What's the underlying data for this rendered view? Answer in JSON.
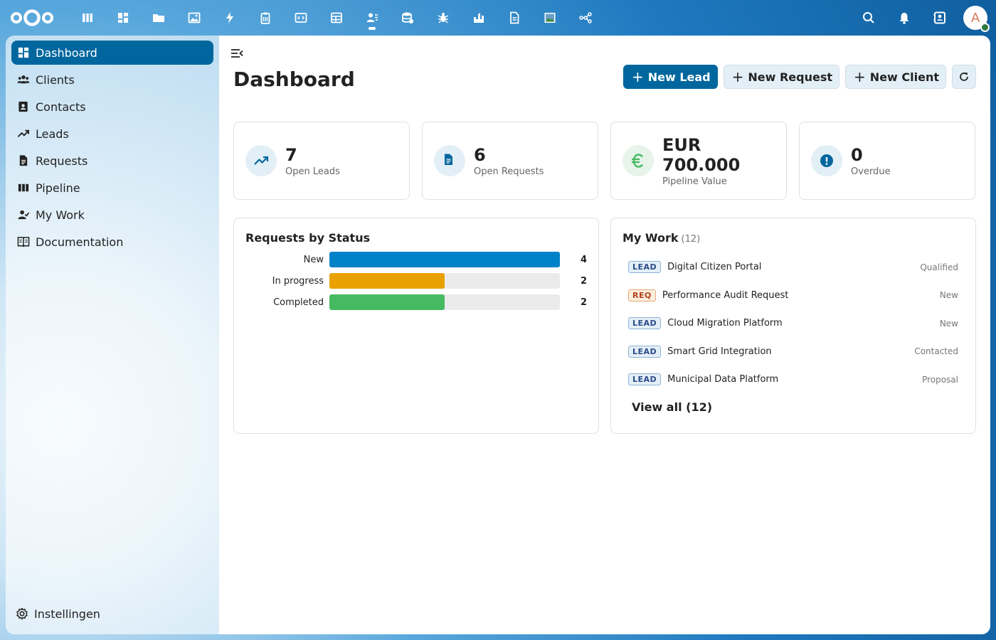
{
  "topbar": {
    "apps": [
      {
        "name": "deck-app-icon",
        "icon": "columns"
      },
      {
        "name": "dashboard-app-icon",
        "icon": "grid"
      },
      {
        "name": "files-app-icon",
        "icon": "folder"
      },
      {
        "name": "photos-app-icon",
        "icon": "image"
      },
      {
        "name": "activity-app-icon",
        "icon": "bolt"
      },
      {
        "name": "clipboard-app-icon",
        "icon": "clipboard"
      },
      {
        "name": "code-app-icon",
        "icon": "code"
      },
      {
        "name": "tables-app-icon",
        "icon": "table"
      },
      {
        "name": "contacts-app-icon",
        "icon": "user-list",
        "active": true
      },
      {
        "name": "database-app-icon",
        "icon": "database"
      },
      {
        "name": "bug-app-icon",
        "icon": "bug"
      },
      {
        "name": "castle-app-icon",
        "icon": "castle"
      },
      {
        "name": "document-app-icon",
        "icon": "document"
      },
      {
        "name": "picture-app-icon",
        "icon": "picture"
      },
      {
        "name": "flow-app-icon",
        "icon": "share"
      }
    ],
    "avatar_letter": "A"
  },
  "sidebar": {
    "items": [
      {
        "label": "Dashboard",
        "icon": "dashboard-icon",
        "active": true
      },
      {
        "label": "Clients",
        "icon": "users-icon"
      },
      {
        "label": "Contacts",
        "icon": "contact-card-icon"
      },
      {
        "label": "Leads",
        "icon": "trend-icon"
      },
      {
        "label": "Requests",
        "icon": "document-icon"
      },
      {
        "label": "Pipeline",
        "icon": "pipeline-icon"
      },
      {
        "label": "My Work",
        "icon": "user-check-icon"
      },
      {
        "label": "Documentation",
        "icon": "book-icon"
      }
    ],
    "settings_label": "Instellingen"
  },
  "main": {
    "title": "Dashboard",
    "actions": {
      "new_lead": "New Lead",
      "new_request": "New Request",
      "new_client": "New Client",
      "plus": "+"
    },
    "stats": [
      {
        "value": "7",
        "label": "Open Leads",
        "icon": "trend-up-icon"
      },
      {
        "value": "6",
        "label": "Open Requests",
        "icon": "document-icon"
      },
      {
        "value": "EUR 700.000",
        "label": "Pipeline Value",
        "icon": "euro-icon"
      },
      {
        "value": "0",
        "label": "Overdue",
        "icon": "alert-icon"
      }
    ]
  },
  "requests_card": {
    "title": "Requests by Status"
  },
  "chart_data": {
    "type": "bar",
    "orientation": "horizontal",
    "title": "Requests by Status",
    "categories": [
      "New",
      "In progress",
      "Completed"
    ],
    "values": [
      4,
      2,
      2
    ],
    "colors": [
      "#0082c9",
      "#e9a100",
      "#46ba61"
    ],
    "xlim": [
      0,
      4
    ]
  },
  "my_work": {
    "title": "My Work",
    "count": "(12)",
    "items": [
      {
        "tag": "LEAD",
        "type": "lead",
        "name": "Digital Citizen Portal",
        "status": "Qualified"
      },
      {
        "tag": "REQ",
        "type": "req",
        "name": "Performance Audit Request",
        "status": "New"
      },
      {
        "tag": "LEAD",
        "type": "lead",
        "name": "Cloud Migration Platform",
        "status": "New"
      },
      {
        "tag": "LEAD",
        "type": "lead",
        "name": "Smart Grid Integration",
        "status": "Contacted"
      },
      {
        "tag": "LEAD",
        "type": "lead",
        "name": "Municipal Data Platform",
        "status": "Proposal"
      }
    ],
    "view_all": "View all (12)"
  },
  "colors": {
    "primary": "#00679e",
    "header": "#0f5f9f",
    "success": "#46ba61",
    "warning": "#e9a100"
  }
}
